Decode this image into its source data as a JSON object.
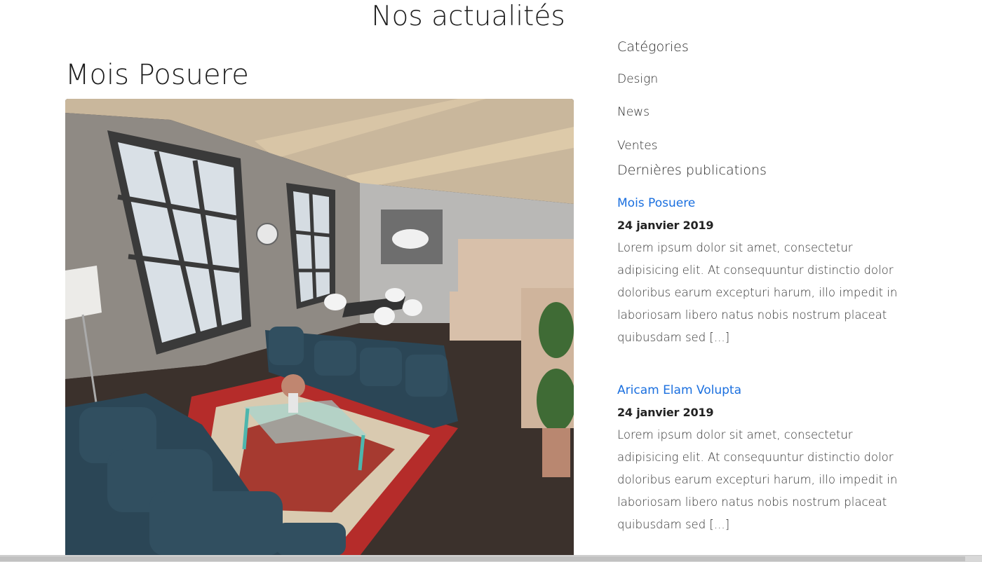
{
  "page": {
    "title": "Nos actualités"
  },
  "post": {
    "title": "Mois Posuere"
  },
  "sidebar": {
    "categories_heading": "Catégories",
    "categories": [
      "Design",
      "News",
      "Ventes"
    ],
    "recent_heading": "Dernières publications",
    "recent": [
      {
        "title": "Mois Posuere",
        "date": "24 janvier 2019",
        "excerpt": "Lorem ipsum dolor sit amet, consectetur adipisicing elit. At consequuntur distinctio dolor doloribus earum excepturi harum, illo impedit in laboriosam libero natus nobis nostrum placeat quibusdam sed [...]"
      },
      {
        "title": "Aricam Elam Volupta",
        "date": "24 janvier 2019",
        "excerpt": "Lorem ipsum dolor sit amet, consectetur adipisicing elit. At consequuntur distinctio dolor doloribus earum excepturi harum, illo impedit in laboriosam libero natus nobis nostrum placeat quibusdam sed [...]"
      }
    ]
  },
  "colors": {
    "link": "#1a6fdf",
    "text": "#222222"
  }
}
